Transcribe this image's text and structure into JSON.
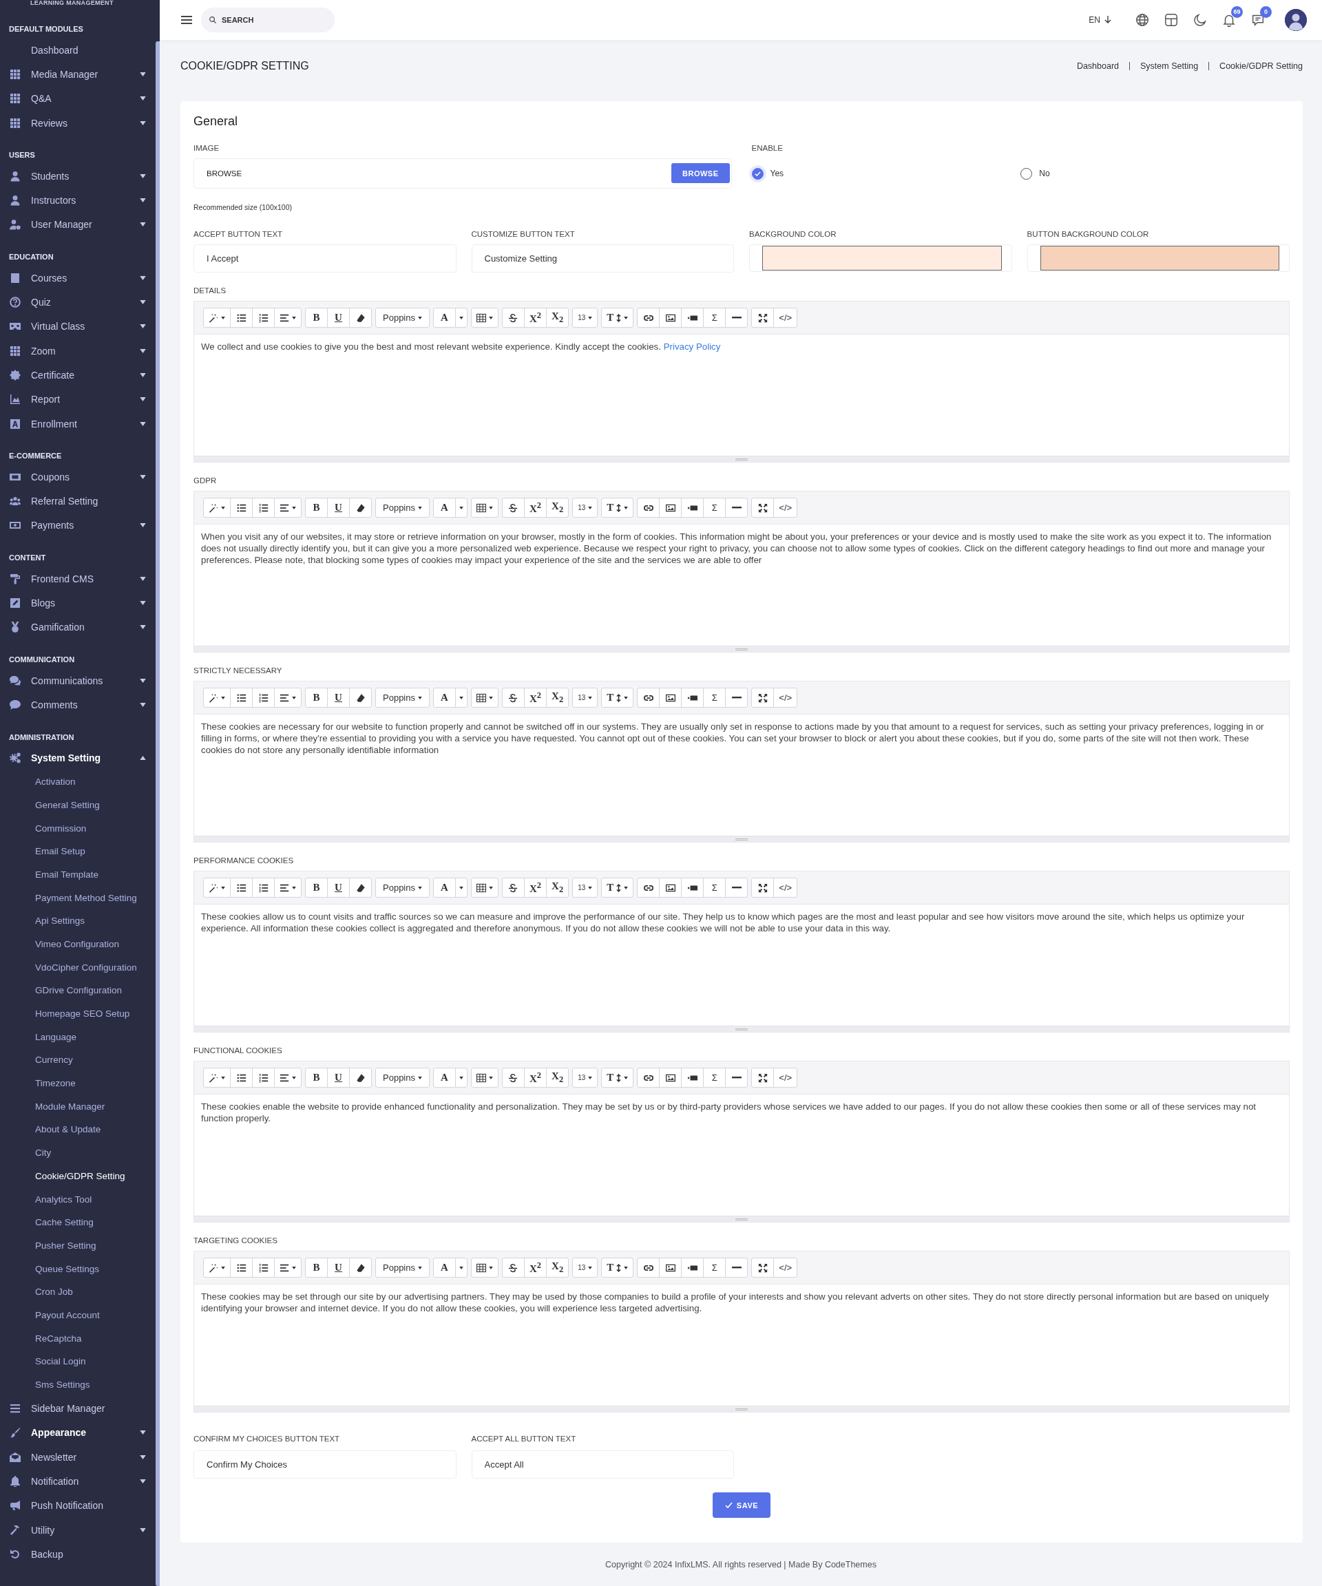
{
  "sidebar": {
    "brand": "LEARNING MANAGEMENT",
    "sections": [
      {
        "title": "DEFAULT MODULES",
        "items": [
          {
            "label": "Dashboard",
            "kind": "none",
            "expandable": false,
            "expanded": false,
            "highlighted": false
          },
          {
            "label": "Media Manager",
            "kind": "grid",
            "expandable": true,
            "expanded": false,
            "highlighted": false
          },
          {
            "label": "Q&A",
            "kind": "grid",
            "expandable": true,
            "expanded": false,
            "highlighted": false
          },
          {
            "label": "Reviews",
            "kind": "grid",
            "expandable": true,
            "expanded": false,
            "highlighted": false
          }
        ]
      },
      {
        "title": "USERS",
        "items": [
          {
            "label": "Students",
            "kind": "user",
            "expandable": true,
            "expanded": false,
            "highlighted": false
          },
          {
            "label": "Instructors",
            "kind": "user",
            "expandable": true,
            "expanded": false,
            "highlighted": false
          },
          {
            "label": "User Manager",
            "kind": "usergear",
            "expandable": true,
            "expanded": false,
            "highlighted": false
          }
        ]
      },
      {
        "title": "EDUCATION",
        "items": [
          {
            "label": "Courses",
            "kind": "book",
            "expandable": true,
            "expanded": false,
            "highlighted": false
          },
          {
            "label": "Quiz",
            "kind": "question",
            "expandable": true,
            "expanded": false,
            "highlighted": false
          },
          {
            "label": "Virtual Class",
            "kind": "vr",
            "expandable": true,
            "expanded": false,
            "highlighted": false
          },
          {
            "label": "Zoom",
            "kind": "grid",
            "expandable": true,
            "expanded": false,
            "highlighted": false
          },
          {
            "label": "Certificate",
            "kind": "badge",
            "expandable": true,
            "expanded": false,
            "highlighted": false
          },
          {
            "label": "Report",
            "kind": "chart",
            "expandable": true,
            "expanded": false,
            "highlighted": false
          },
          {
            "label": "Enrollment",
            "kind": "letter",
            "expandable": true,
            "expanded": false,
            "highlighted": false
          }
        ]
      },
      {
        "title": "E-COMMERCE",
        "items": [
          {
            "label": "Coupons",
            "kind": "ticket",
            "expandable": true,
            "expanded": false,
            "highlighted": false
          },
          {
            "label": "Referral Setting",
            "kind": "users",
            "expandable": false,
            "expanded": false,
            "highlighted": false
          },
          {
            "label": "Payments",
            "kind": "money",
            "expandable": true,
            "expanded": false,
            "highlighted": false
          }
        ]
      },
      {
        "title": "CONTENT",
        "items": [
          {
            "label": "Frontend CMS",
            "kind": "roller",
            "expandable": true,
            "expanded": false,
            "highlighted": false
          },
          {
            "label": "Blogs",
            "kind": "pen",
            "expandable": true,
            "expanded": false,
            "highlighted": false
          },
          {
            "label": "Gamification",
            "kind": "medal",
            "expandable": true,
            "expanded": false,
            "highlighted": false
          }
        ]
      },
      {
        "title": "COMMUNICATION",
        "items": [
          {
            "label": "Communications",
            "kind": "comments",
            "expandable": true,
            "expanded": false,
            "highlighted": false
          },
          {
            "label": "Comments",
            "kind": "comment",
            "expandable": true,
            "expanded": false,
            "highlighted": false
          }
        ]
      },
      {
        "title": "ADMINISTRATION",
        "items": [
          {
            "label": "System Setting",
            "kind": "gears",
            "expandable": true,
            "expanded": true,
            "highlighted": true,
            "children": [
              {
                "label": "Activation",
                "selected": false
              },
              {
                "label": "General Setting",
                "selected": false
              },
              {
                "label": "Commission",
                "selected": false
              },
              {
                "label": "Email Setup",
                "selected": false
              },
              {
                "label": "Email Template",
                "selected": false
              },
              {
                "label": "Payment Method Setting",
                "selected": false
              },
              {
                "label": "Api Settings",
                "selected": false
              },
              {
                "label": "Vimeo Configuration",
                "selected": false
              },
              {
                "label": "VdoCipher Configuration",
                "selected": false
              },
              {
                "label": "GDrive Configuration",
                "selected": false
              },
              {
                "label": "Homepage SEO Setup",
                "selected": false
              },
              {
                "label": "Language",
                "selected": false
              },
              {
                "label": "Currency",
                "selected": false
              },
              {
                "label": "Timezone",
                "selected": false
              },
              {
                "label": "Module Manager",
                "selected": false
              },
              {
                "label": "About & Update",
                "selected": false
              },
              {
                "label": "City",
                "selected": false
              },
              {
                "label": "Cookie/GDPR Setting",
                "selected": true
              },
              {
                "label": "Analytics Tool",
                "selected": false
              },
              {
                "label": "Cache Setting",
                "selected": false
              },
              {
                "label": "Pusher Setting",
                "selected": false
              },
              {
                "label": "Queue Settings",
                "selected": false
              },
              {
                "label": "Cron Job",
                "selected": false
              },
              {
                "label": "Payout Account",
                "selected": false
              },
              {
                "label": "ReCaptcha",
                "selected": false
              },
              {
                "label": "Social Login",
                "selected": false
              },
              {
                "label": "Sms Settings",
                "selected": false
              }
            ]
          },
          {
            "label": "Sidebar Manager",
            "kind": "bars",
            "expandable": false,
            "expanded": false,
            "highlighted": false
          },
          {
            "label": "Appearance",
            "kind": "brush",
            "expandable": true,
            "expanded": false,
            "highlighted": true
          },
          {
            "label": "Newsletter",
            "kind": "envelope",
            "expandable": true,
            "expanded": false,
            "highlighted": false
          },
          {
            "label": "Notification",
            "kind": "bell",
            "expandable": true,
            "expanded": false,
            "highlighted": false
          },
          {
            "label": "Push Notification",
            "kind": "megaphone",
            "expandable": false,
            "expanded": false,
            "highlighted": false
          },
          {
            "label": "Utility",
            "kind": "hammer",
            "expandable": true,
            "expanded": false,
            "highlighted": false
          },
          {
            "label": "Backup",
            "kind": "undo",
            "expandable": false,
            "expanded": false,
            "highlighted": false
          }
        ]
      }
    ]
  },
  "topbar": {
    "search": {
      "placeholder": "SEARCH"
    },
    "language": "EN",
    "notification_count": "69",
    "message_count": "0"
  },
  "page": {
    "title": "COOKIE/GDPR SETTING",
    "breadcrumb": [
      "Dashboard",
      "System Setting",
      "Cookie/GDPR Setting"
    ]
  },
  "form": {
    "heading": "General",
    "image": {
      "label": "IMAGE",
      "placeholder": "BROWSE",
      "button": "BROWSE",
      "hint": "Recommended size (100x100)"
    },
    "enable": {
      "label": "ENABLE",
      "options": [
        {
          "label": "Yes",
          "selected": true
        },
        {
          "label": "No",
          "selected": false
        }
      ]
    },
    "text_fields": [
      {
        "label": "ACCEPT BUTTON TEXT",
        "value": "I Accept"
      },
      {
        "label": "CUSTOMIZE BUTTON TEXT",
        "value": "Customize Setting"
      }
    ],
    "color_fields": [
      {
        "label": "BACKGROUND COLOR",
        "color": "#ffebe0"
      },
      {
        "label": "BUTTON BACKGROUND COLOR",
        "color": "#f7d2bb"
      }
    ],
    "editors": [
      {
        "label": "DETAILS",
        "toolbar": [
          [
            {
              "kind": "wand",
              "caret": true
            },
            {
              "kind": "bullets"
            },
            {
              "kind": "numbers"
            },
            {
              "kind": "align",
              "caret": true
            }
          ],
          [
            {
              "kind": "bold",
              "label": "B"
            },
            {
              "kind": "underline",
              "label": "U"
            },
            {
              "kind": "eraser"
            }
          ],
          [
            {
              "kind": "font",
              "label": "Poppins",
              "caret": true
            }
          ],
          [
            {
              "kind": "color",
              "label": "A"
            },
            {
              "kind": "caret"
            }
          ],
          [
            {
              "kind": "table",
              "caret": true
            }
          ],
          [
            {
              "kind": "strike"
            },
            {
              "kind": "superscript",
              "label": "X$^{2}$"
            },
            {
              "kind": "subscript",
              "label": "X$_{2}$"
            }
          ],
          [
            {
              "kind": "size",
              "label": "13",
              "caret": true
            }
          ],
          [
            {
              "kind": "lineheight",
              "label": "T",
              "caret": true
            }
          ],
          [
            {
              "kind": "link"
            },
            {
              "kind": "picture"
            },
            {
              "kind": "video"
            },
            {
              "kind": "math",
              "label": "Σ"
            },
            {
              "kind": "rule"
            }
          ],
          [
            {
              "kind": "expand"
            },
            {
              "kind": "code",
              "label": "</>"
            }
          ]
        ],
        "text": "We collect and use cookies to give you the best and most relevant website experience. Kindly accept the cookies.",
        "link": "Privacy Policy"
      },
      {
        "label": "GDPR",
        "toolbar": [
          [
            {
              "kind": "wand",
              "caret": true
            },
            {
              "kind": "bullets"
            },
            {
              "kind": "numbers"
            },
            {
              "kind": "align",
              "caret": true
            }
          ],
          [
            {
              "kind": "bold",
              "label": "B"
            },
            {
              "kind": "underline",
              "label": "U"
            },
            {
              "kind": "eraser"
            }
          ],
          [
            {
              "kind": "font",
              "label": "Poppins",
              "caret": true
            }
          ],
          [
            {
              "kind": "color",
              "label": "A"
            },
            {
              "kind": "caret"
            }
          ],
          [
            {
              "kind": "table",
              "caret": true
            }
          ],
          [
            {
              "kind": "strike"
            },
            {
              "kind": "superscript",
              "label": "X$^{2}$"
            },
            {
              "kind": "subscript",
              "label": "X$_{2}$"
            }
          ],
          [
            {
              "kind": "size",
              "label": "13",
              "caret": true
            }
          ],
          [
            {
              "kind": "lineheight",
              "label": "T",
              "caret": true
            }
          ],
          [
            {
              "kind": "link"
            },
            {
              "kind": "picture"
            },
            {
              "kind": "video"
            },
            {
              "kind": "math",
              "label": "Σ"
            },
            {
              "kind": "rule"
            }
          ],
          [
            {
              "kind": "expand"
            },
            {
              "kind": "code",
              "label": "</>"
            }
          ]
        ],
        "text": "When you visit any of our websites, it may store or retrieve information on your browser, mostly in the form of cookies. This information might be about you, your preferences or your device and is mostly used to make the site work as you expect it to. The information does not usually directly identify you, but it can give you a more personalized web experience. Because we respect your right to privacy, you can choose not to allow some types of cookies. Click on the different category headings to find out more and manage your preferences. Please note, that blocking some types of cookies may impact your experience of the site and the services we are able to offer"
      },
      {
        "label": "STRICTLY NECESSARY",
        "toolbar": [
          [
            {
              "kind": "wand",
              "caret": true
            },
            {
              "kind": "bullets"
            },
            {
              "kind": "numbers"
            },
            {
              "kind": "align",
              "caret": true
            }
          ],
          [
            {
              "kind": "bold",
              "label": "B"
            },
            {
              "kind": "underline",
              "label": "U"
            },
            {
              "kind": "eraser"
            }
          ],
          [
            {
              "kind": "font",
              "label": "Poppins",
              "caret": true
            }
          ],
          [
            {
              "kind": "color",
              "label": "A"
            },
            {
              "kind": "caret"
            }
          ],
          [
            {
              "kind": "table",
              "caret": true
            }
          ],
          [
            {
              "kind": "strike"
            },
            {
              "kind": "superscript",
              "label": "X$^{2}$"
            },
            {
              "kind": "subscript",
              "label": "X$_{2}$"
            }
          ],
          [
            {
              "kind": "size",
              "label": "13",
              "caret": true
            }
          ],
          [
            {
              "kind": "lineheight",
              "label": "T",
              "caret": true
            }
          ],
          [
            {
              "kind": "link"
            },
            {
              "kind": "picture"
            },
            {
              "kind": "video"
            },
            {
              "kind": "math",
              "label": "Σ"
            },
            {
              "kind": "rule"
            }
          ],
          [
            {
              "kind": "expand"
            },
            {
              "kind": "code",
              "label": "</>"
            }
          ]
        ],
        "text": "These cookies are necessary for our website to function properly and cannot be switched off in our systems. They are usually only set in response to actions made by you that amount to a request for services, such as setting your privacy preferences, logging in or filling in forms, or where they're essential to providing you with a service you have requested. You cannot opt out of these cookies. You can set your browser to block or alert you about these cookies, but if you do, some parts of the site will not then work. These cookies do not store any personally identifiable information"
      },
      {
        "label": "PERFORMANCE COOKIES",
        "toolbar": [
          [
            {
              "kind": "wand",
              "caret": true
            },
            {
              "kind": "bullets"
            },
            {
              "kind": "numbers"
            },
            {
              "kind": "align",
              "caret": true
            }
          ],
          [
            {
              "kind": "bold",
              "label": "B"
            },
            {
              "kind": "underline",
              "label": "U"
            },
            {
              "kind": "eraser"
            }
          ],
          [
            {
              "kind": "font",
              "label": "Poppins",
              "caret": true
            }
          ],
          [
            {
              "kind": "color",
              "label": "A"
            },
            {
              "kind": "caret"
            }
          ],
          [
            {
              "kind": "table",
              "caret": true
            }
          ],
          [
            {
              "kind": "strike"
            },
            {
              "kind": "superscript",
              "label": "X$^{2}$"
            },
            {
              "kind": "subscript",
              "label": "X$_{2}$"
            }
          ],
          [
            {
              "kind": "size",
              "label": "13",
              "caret": true
            }
          ],
          [
            {
              "kind": "lineheight",
              "label": "T",
              "caret": true
            }
          ],
          [
            {
              "kind": "link"
            },
            {
              "kind": "picture"
            },
            {
              "kind": "video"
            },
            {
              "kind": "math",
              "label": "Σ"
            },
            {
              "kind": "rule"
            }
          ],
          [
            {
              "kind": "expand"
            },
            {
              "kind": "code",
              "label": "</>"
            }
          ]
        ],
        "text": "These cookies allow us to count visits and traffic sources so we can measure and improve the performance of our site. They help us to know which pages are the most and least popular and see how visitors move around the site, which helps us optimize your experience. All information these cookies collect is aggregated and therefore anonymous. If you do not allow these cookies we will not be able to use your data in this way."
      },
      {
        "label": "FUNCTIONAL COOKIES",
        "toolbar": [
          [
            {
              "kind": "wand",
              "caret": true
            },
            {
              "kind": "bullets"
            },
            {
              "kind": "numbers"
            },
            {
              "kind": "align",
              "caret": true
            }
          ],
          [
            {
              "kind": "bold",
              "label": "B"
            },
            {
              "kind": "underline",
              "label": "U"
            },
            {
              "kind": "eraser"
            }
          ],
          [
            {
              "kind": "font",
              "label": "Poppins",
              "caret": true
            }
          ],
          [
            {
              "kind": "color",
              "label": "A"
            },
            {
              "kind": "caret"
            }
          ],
          [
            {
              "kind": "table",
              "caret": true
            }
          ],
          [
            {
              "kind": "strike"
            },
            {
              "kind": "superscript",
              "label": "X$^{2}$"
            },
            {
              "kind": "subscript",
              "label": "X$_{2}$"
            }
          ],
          [
            {
              "kind": "size",
              "label": "13",
              "caret": true
            }
          ],
          [
            {
              "kind": "lineheight",
              "label": "T",
              "caret": true
            }
          ],
          [
            {
              "kind": "link"
            },
            {
              "kind": "picture"
            },
            {
              "kind": "video"
            },
            {
              "kind": "math",
              "label": "Σ"
            },
            {
              "kind": "rule"
            }
          ],
          [
            {
              "kind": "expand"
            },
            {
              "kind": "code",
              "label": "</>"
            }
          ]
        ],
        "text": "These cookies enable the website to provide enhanced functionality and personalization. They may be set by us or by third-party providers whose services we have added to our pages. If you do not allow these cookies then some or all of these services may not function properly."
      },
      {
        "label": "TARGETING COOKIES",
        "toolbar": [
          [
            {
              "kind": "wand",
              "caret": true
            },
            {
              "kind": "bullets"
            },
            {
              "kind": "numbers"
            },
            {
              "kind": "align",
              "caret": true
            }
          ],
          [
            {
              "kind": "bold",
              "label": "B"
            },
            {
              "kind": "underline",
              "label": "U"
            },
            {
              "kind": "eraser"
            }
          ],
          [
            {
              "kind": "font",
              "label": "Poppins",
              "caret": true
            }
          ],
          [
            {
              "kind": "color",
              "label": "A"
            },
            {
              "kind": "caret"
            }
          ],
          [
            {
              "kind": "table",
              "caret": true
            }
          ],
          [
            {
              "kind": "strike"
            },
            {
              "kind": "superscript",
              "label": "X$^{2}$"
            },
            {
              "kind": "subscript",
              "label": "X$_{2}$"
            }
          ],
          [
            {
              "kind": "size",
              "label": "13",
              "caret": true
            }
          ],
          [
            {
              "kind": "lineheight",
              "label": "T",
              "caret": true
            }
          ],
          [
            {
              "kind": "link"
            },
            {
              "kind": "picture"
            },
            {
              "kind": "video"
            },
            {
              "kind": "math",
              "label": "Σ"
            },
            {
              "kind": "rule"
            }
          ],
          [
            {
              "kind": "expand"
            },
            {
              "kind": "code",
              "label": "</>"
            }
          ]
        ],
        "text": "These cookies may be set through our site by our advertising partners. They may be used by those companies to build a profile of your interests and show you relevant adverts on other sites. They do not store directly personal information but are based on uniquely identifying your browser and internet device. If you do not allow these cookies, you will experience less targeted advertising."
      }
    ],
    "bottom_fields": [
      {
        "label": "CONFIRM MY CHOICES BUTTON TEXT",
        "value": "Confirm My Choices"
      },
      {
        "label": "ACCEPT ALL BUTTON TEXT",
        "value": "Accept All"
      }
    ],
    "save_button": "SAVE"
  },
  "footer": "Copyright © 2024 InfixLMS. All rights reserved | Made By CodeThemes"
}
